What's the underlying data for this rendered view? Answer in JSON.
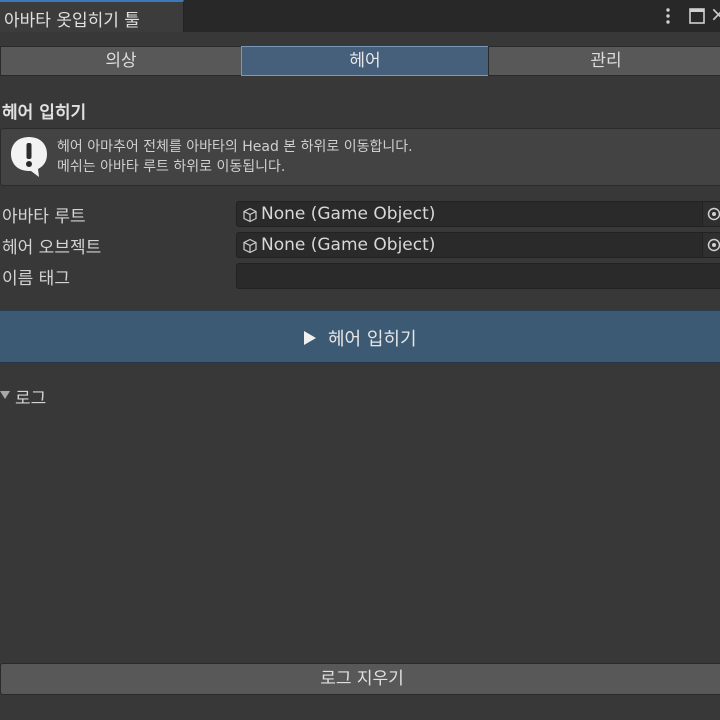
{
  "window": {
    "title": "아바타 옷입히기 툴",
    "icons": [
      "kebab-menu-icon",
      "maximize-icon",
      "close-icon"
    ]
  },
  "tabs": [
    {
      "label": "의상",
      "active": false
    },
    {
      "label": "헤어",
      "active": true
    },
    {
      "label": "관리",
      "active": false
    }
  ],
  "section": {
    "title": "헤어 입히기",
    "help_lines": [
      "헤어 아마추어 전체를 아바타의 Head 본 하위로 이동합니다.",
      "메쉬는 아바타 루트 하위로 이동됩니다."
    ]
  },
  "fields": {
    "avatar_root": {
      "label": "아바타 루트",
      "value": "None (Game Object)"
    },
    "hair_object": {
      "label": "헤어 오브젝트",
      "value": "None (Game Object)"
    },
    "name_tag": {
      "label": "이름 태그",
      "value": ""
    }
  },
  "actions": {
    "apply_label": "헤어 입히기",
    "log_label": "로그",
    "clear_log_label": "로그 지우기"
  },
  "colors": {
    "background": "#383838",
    "active_tab": "#46607c",
    "primary_button": "#3c5a73",
    "accent": "#3a79bb"
  }
}
